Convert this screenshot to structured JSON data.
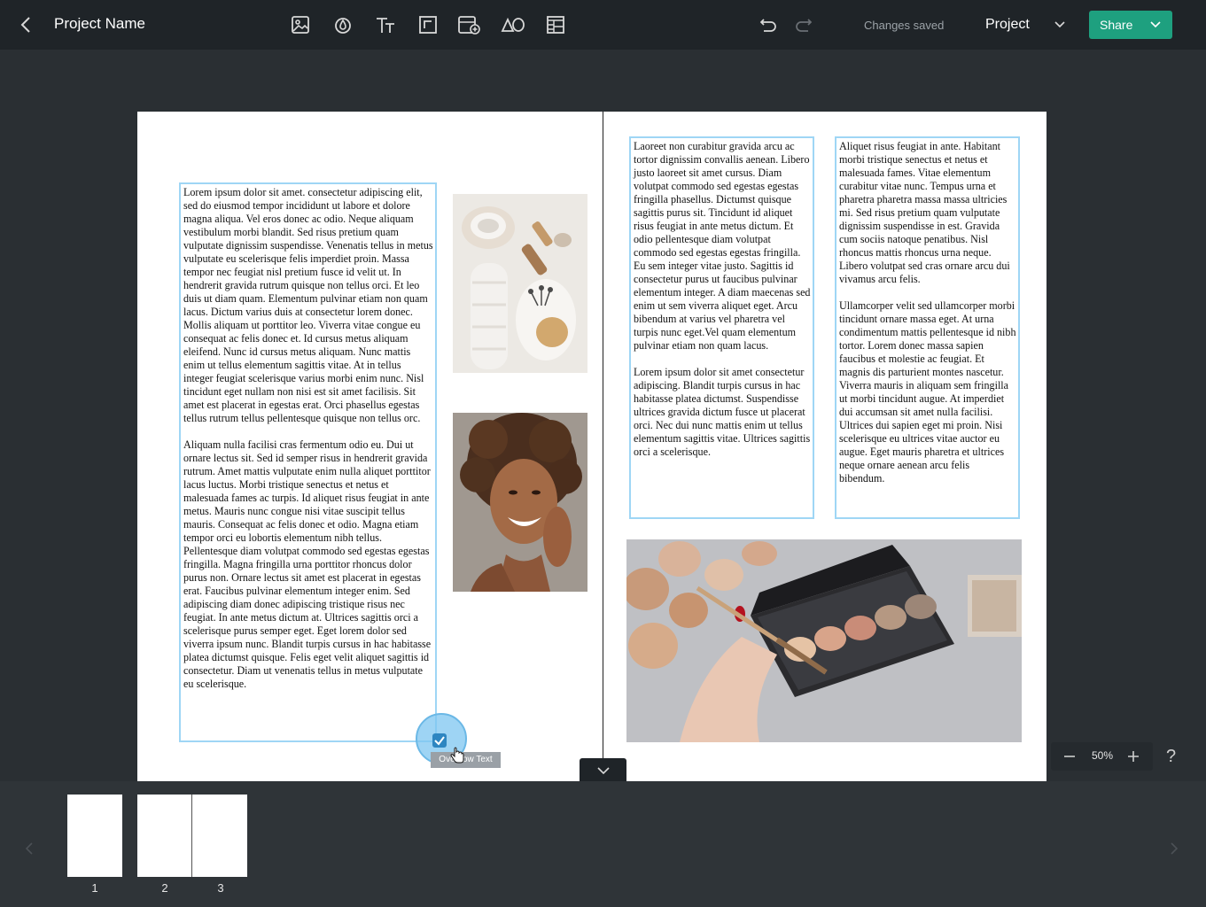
{
  "header": {
    "back_icon": "chevron-left-icon",
    "project_name": "Project Name",
    "tools": [
      "image-icon",
      "droplet-icon",
      "text-icon",
      "resize-icon",
      "add-page-icon",
      "shapes-icon",
      "layout-icon"
    ],
    "undo_icon": "undo-icon",
    "redo_icon": "redo-icon",
    "status": "Changes saved",
    "project_menu": "Project",
    "share_label": "Share"
  },
  "canvas": {
    "left_text": [
      "Lorem ipsum dolor sit amet. consectetur adipiscing elit, sed do eiusmod tempor incididunt ut labore et dolore magna aliqua. Vel eros donec ac odio. Neque aliquam vestibulum morbi blandit. Sed risus pretium quam vulputate dignissim suspendisse. Venenatis tellus in metus vulputate eu scelerisque felis imperdiet proin. Massa tempor nec feugiat nisl pretium fusce id velit ut. In hendrerit gravida rutrum quisque non tellus orci. Et leo duis ut diam quam. Elementum pulvinar etiam non quam lacus. Dictum varius duis at consectetur lorem donec. Mollis aliquam ut porttitor leo. Viverra vitae congue eu consequat ac felis donec et. Id cursus metus aliquam eleifend. Nunc id cursus metus aliquam. Nunc mattis enim ut tellus elementum sagittis vitae. At in tellus integer feugiat scelerisque varius morbi enim nunc. Nisl tincidunt eget nullam non nisi est sit amet facilisis. Sit amet est placerat in egestas erat. Orci phasellus egestas tellus rutrum tellus pellentesque quisque non tellus orc.",
      "Aliquam nulla facilisi cras fermentum odio eu. Dui ut ornare lectus sit. Sed id semper risus in hendrerit gravida rutrum. Amet mattis vulputate enim nulla aliquet porttitor lacus luctus. Morbi tristique senectus et netus et malesuada fames ac turpis. Id aliquet risus feugiat in ante metus. Mauris nunc congue nisi vitae suscipit tellus mauris. Consequat ac felis donec et odio. Magna etiam tempor orci eu lobortis elementum nibh tellus. Pellentesque diam volutpat commodo sed egestas egestas fringilla. Magna fringilla urna porttitor rhoncus dolor purus non. Ornare lectus sit amet est placerat in egestas erat. Faucibus pulvinar elementum integer enim. Sed adipiscing diam donec adipiscing tristique risus nec feugiat. In ante metus dictum at. Ultrices sagittis orci a scelerisque purus semper eget. Eget lorem dolor sed viverra ipsum nunc. Blandit turpis cursus in hac habitasse platea dictumst quisque. Felis eget velit aliquet sagittis id consectetur. Diam ut venenatis tellus in metus vulputate eu scelerisque."
    ],
    "mid_text": [
      "Laoreet non curabitur gravida arcu ac tortor dignissim convallis aenean. Libero justo laoreet sit amet cursus. Diam volutpat commodo sed egestas egestas fringilla phasellus. Dictumst quisque sagittis purus sit. Tincidunt id aliquet risus feugiat in ante metus dictum. Et odio pellentesque diam volutpat commodo sed egestas egestas fringilla. Eu sem integer vitae justo. Sagittis id consectetur purus ut faucibus pulvinar elementum integer. A diam maecenas sed enim ut sem viverra aliquet eget. Arcu bibendum at varius vel pharetra vel turpis nunc eget.Vel quam elementum pulvinar etiam non quam lacus.",
      "Lorem ipsum dolor sit amet consectetur adipiscing. Blandit turpis cursus in hac habitasse platea dictumst. Suspendisse ultrices gravida dictum fusce ut placerat orci. Nec dui nunc mattis enim ut tellus elementum sagittis vitae. Ultrices sagittis orci a scelerisque."
    ],
    "right_text": [
      "Aliquet risus feugiat in ante. Habitant morbi tristique senectus et netus et malesuada fames. Vitae elementum curabitur vitae nunc. Tempus urna et pharetra pharetra massa massa ultricies mi. Sed risus pretium quam vulputate dignissim suspendisse in est. Gravida cum sociis natoque penatibus. Nisl rhoncus mattis rhoncus urna neque. Libero volutpat sed cras ornare arcu dui vivamus arcu felis.",
      "Ullamcorper velit sed ullamcorper morbi tincidunt ornare massa eget. At urna condimentum mattis pellentesque id nibh tortor. Lorem donec massa sapien faucibus et molestie ac feugiat. Et magnis dis parturient montes nascetur. Viverra mauris in aliquam sem fringilla ut morbi tincidunt augue. At imperdiet dui accumsan sit amet nulla facilisi. Ultrices dui sapien eget mi proin. Nisi scelerisque eu ultrices vitae auctor eu augue. Eget mauris pharetra et ultrices neque ornare aenean arcu felis bibendum."
    ],
    "overflow_tooltip": "Overflow Text",
    "zoom": "50%",
    "help": "?"
  },
  "pages": {
    "labels": [
      "1",
      "2",
      "3"
    ]
  },
  "colors": {
    "accent": "#1ea07f",
    "selection": "#9fd6f5",
    "topbar": "#1f2428",
    "canvas": "#2a2f33"
  }
}
